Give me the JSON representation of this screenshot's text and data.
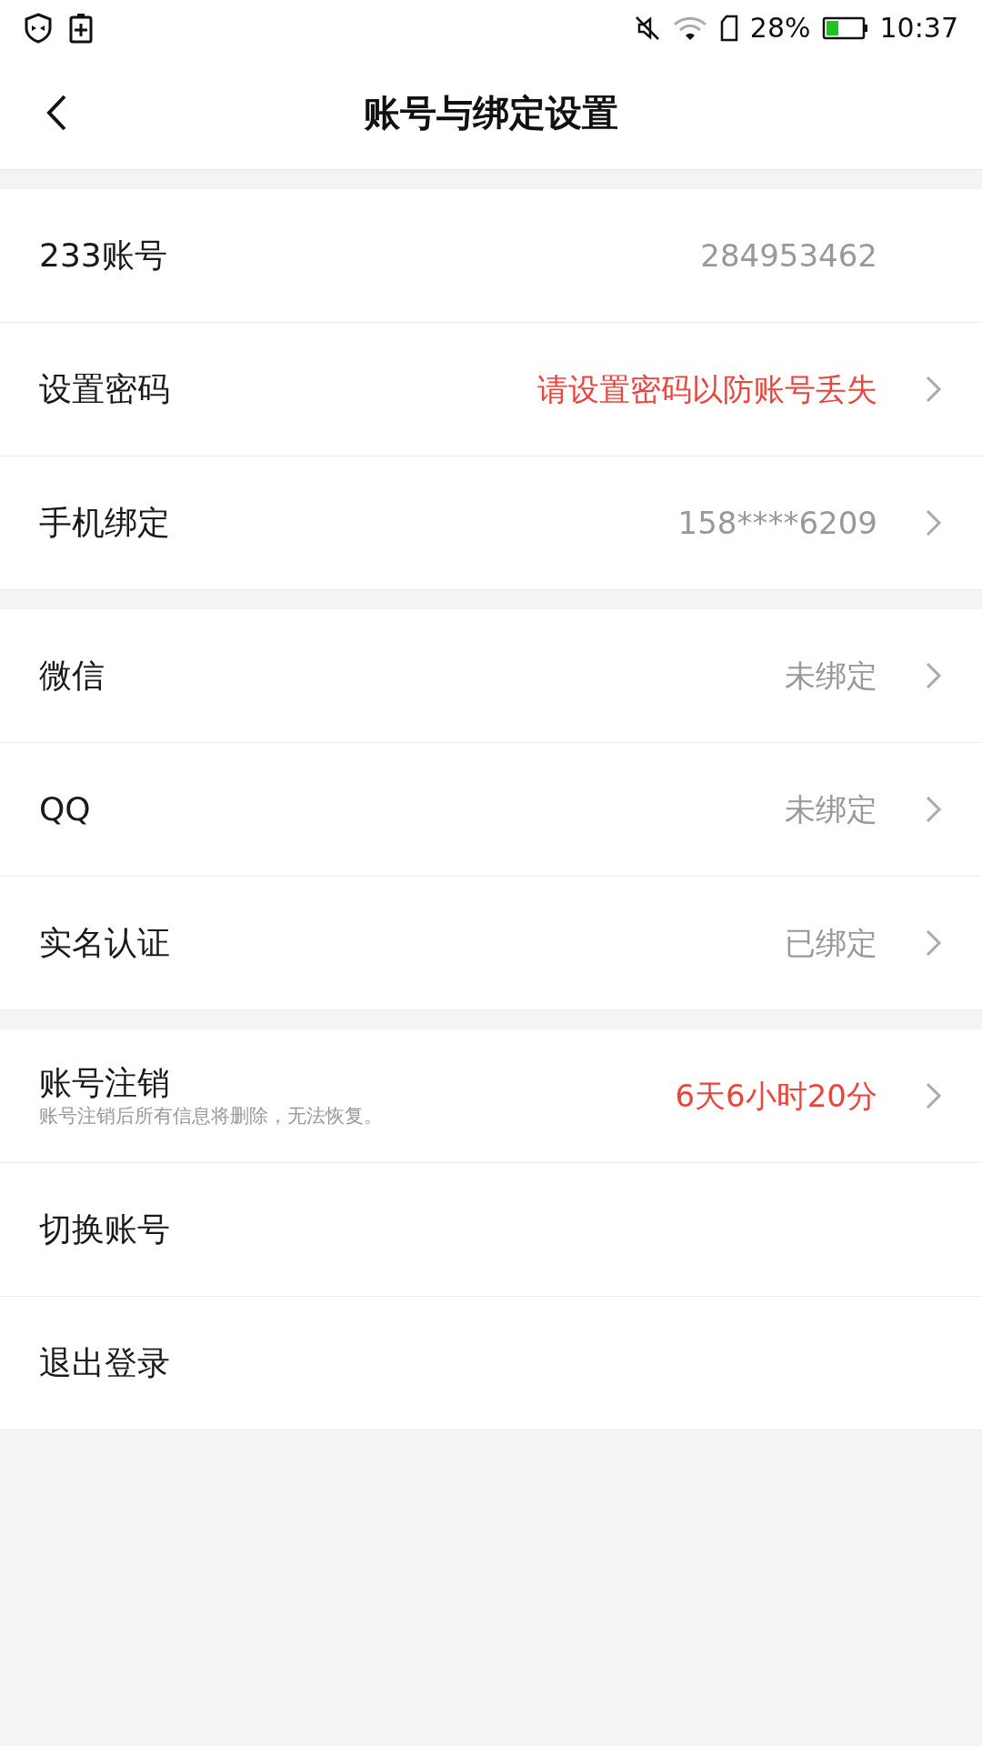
{
  "status_bar": {
    "battery": "28%",
    "time": "10:37"
  },
  "header": {
    "title": "账号与绑定设置"
  },
  "sections": [
    {
      "rows": [
        {
          "label": "233账号",
          "value": "284953462",
          "warning": false,
          "chevron": false
        },
        {
          "label": "设置密码",
          "value": "请设置密码以防账号丢失",
          "warning": true,
          "chevron": true
        },
        {
          "label": "手机绑定",
          "value": "158****6209",
          "warning": false,
          "chevron": true
        }
      ]
    },
    {
      "rows": [
        {
          "label": "微信",
          "value": "未绑定",
          "warning": false,
          "chevron": true
        },
        {
          "label": "QQ",
          "value": "未绑定",
          "warning": false,
          "chevron": true
        },
        {
          "label": "实名认证",
          "value": "已绑定",
          "warning": false,
          "chevron": true
        }
      ]
    },
    {
      "rows": [
        {
          "label": "账号注销",
          "subtitle": "账号注销后所有信息将删除，无法恢复。",
          "value": "6天6小时20分",
          "warning": true,
          "chevron": true
        },
        {
          "label": "切换账号",
          "chevron": false
        },
        {
          "label": "退出登录",
          "chevron": false
        }
      ]
    }
  ]
}
